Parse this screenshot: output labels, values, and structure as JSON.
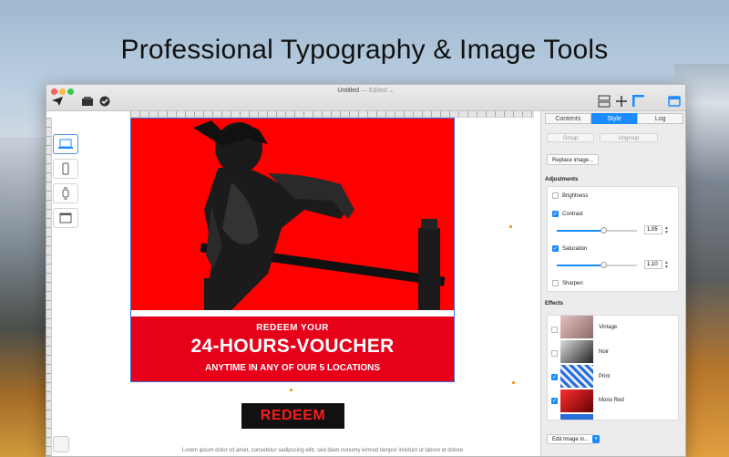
{
  "headline": "Professional Typography & Image Tools",
  "window": {
    "title": "Untitled",
    "title_suffix": "— Edited ⌄"
  },
  "canvas": {
    "art_line1": "REDEEM YOUR",
    "art_line2": "24-HOURS-VOUCHER",
    "art_line3": "ANYTIME IN ANY OF OUR 5 LOCATIONS",
    "redeem_label": "REDEEM",
    "lorem": "Lorem ipsum dolor sit amet, consetetur sadipscing elitr, sed diam nonumy eirmod tempor invidunt ut labore et dolore"
  },
  "inspector": {
    "tabs": [
      {
        "label": "Contents",
        "active": false
      },
      {
        "label": "Style",
        "active": true
      },
      {
        "label": "Log",
        "active": false
      }
    ],
    "group_label": "Group",
    "ungroup_label": "Ungroup",
    "replace_label": "Replace image...",
    "adjustments_title": "Adjustments",
    "adjustments": {
      "brightness": {
        "label": "Brightness",
        "checked": false
      },
      "contrast": {
        "label": "Contrast",
        "checked": true,
        "value": "1,05",
        "level": 0.58
      },
      "saturation": {
        "label": "Saturation",
        "checked": true,
        "value": "1,10",
        "level": 0.58
      },
      "sharpen": {
        "label": "Sharpen",
        "checked": false
      }
    },
    "effects_title": "Effects",
    "effects": [
      {
        "label": "Vintage",
        "checked": false
      },
      {
        "label": "Noir",
        "checked": false
      },
      {
        "label": "Print",
        "checked": true
      },
      {
        "label": "Mono Red",
        "checked": true
      }
    ],
    "edit_label": "Edit Image in..."
  },
  "colors": {
    "accent": "#1a8cff",
    "artboard": "#ff0000"
  }
}
